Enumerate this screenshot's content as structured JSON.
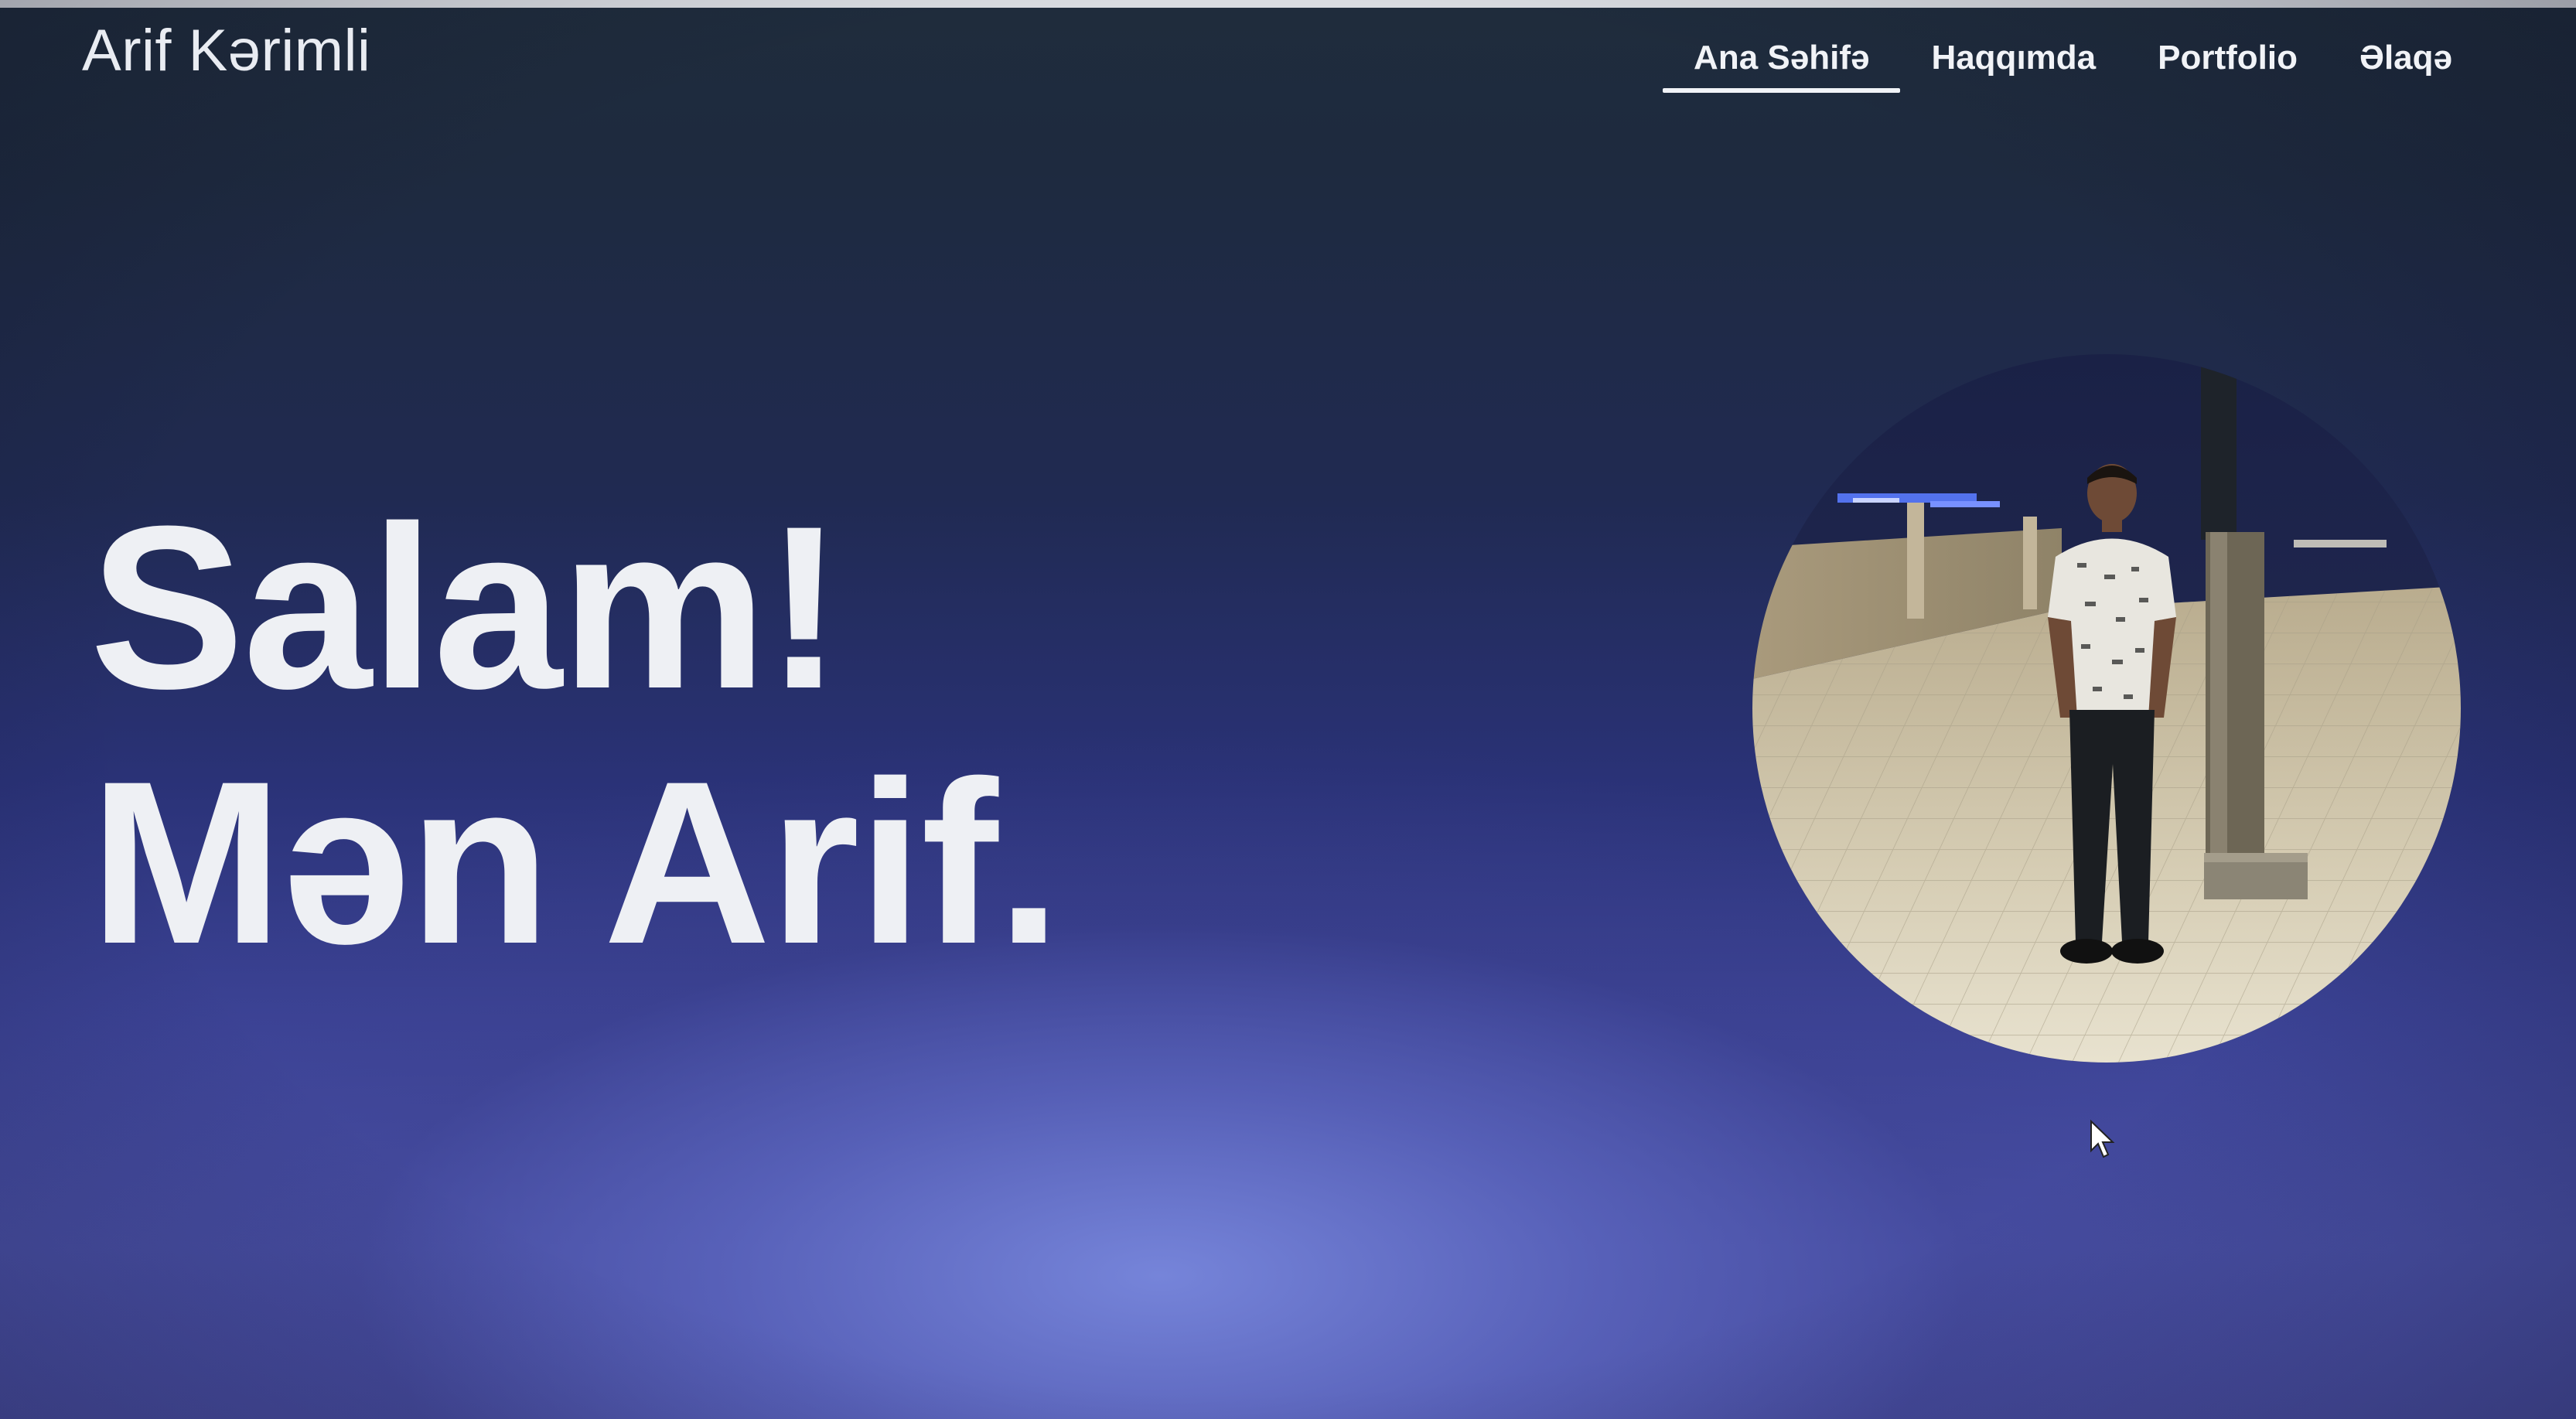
{
  "site": {
    "logo": "Arif Kərimli"
  },
  "nav": {
    "items": [
      {
        "label": "Ana Səhifə",
        "active": true
      },
      {
        "label": "Haqqımda",
        "active": false
      },
      {
        "label": "Portfolio",
        "active": false
      },
      {
        "label": "Əlaqə",
        "active": false
      }
    ]
  },
  "hero": {
    "line1": "Salam!",
    "line2": "Mən Arif."
  },
  "colors": {
    "background_top": "#1f2c3c",
    "background_bottom": "#4b52aa",
    "text": "#eef0f4",
    "nav_underline": "#f1f3f7"
  },
  "icons": {
    "cursor": "mouse-pointer-icon"
  }
}
